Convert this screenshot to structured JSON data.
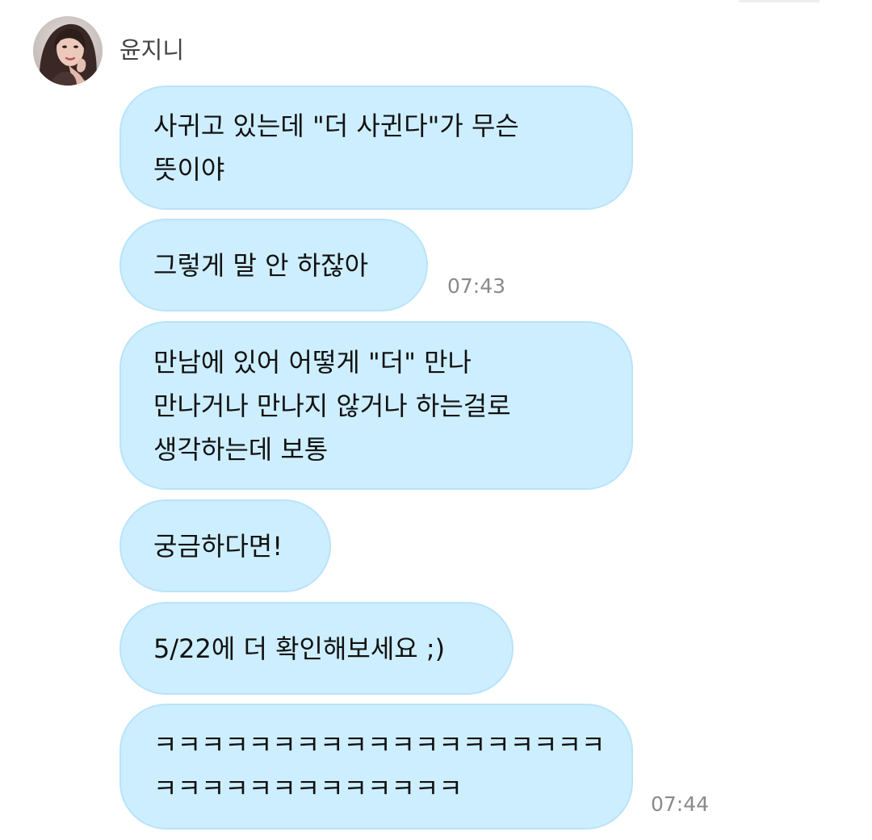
{
  "chat": {
    "sender": {
      "name": "윤지니",
      "avatar_icon": "profile-photo"
    },
    "bubble_color": "#cdeeff",
    "messages": [
      {
        "text": "사귀고 있는데 \"더 사귄다\"가 무슨\n뜻이야",
        "time": ""
      },
      {
        "text": "그렇게 말 안 하잖아",
        "time": "07:43"
      },
      {
        "text": "만남에 있어 어떻게 \"더\" 만나\n만나거나 만나지 않거나 하는걸로\n생각하는데 보통",
        "time": ""
      },
      {
        "text": "궁금하다면!",
        "time": ""
      },
      {
        "text": "5/22에 더 확인해보세요 ;)",
        "time": ""
      },
      {
        "text": "ㅋㅋㅋㅋㅋㅋㅋㅋㅋㅋㅋㅋㅋㅋㅋㅋㅋㅋㅋ\nㅋㅋㅋㅋㅋㅋㅋㅋㅋㅋㅋㅋㅋ",
        "time": "07:44"
      }
    ]
  }
}
